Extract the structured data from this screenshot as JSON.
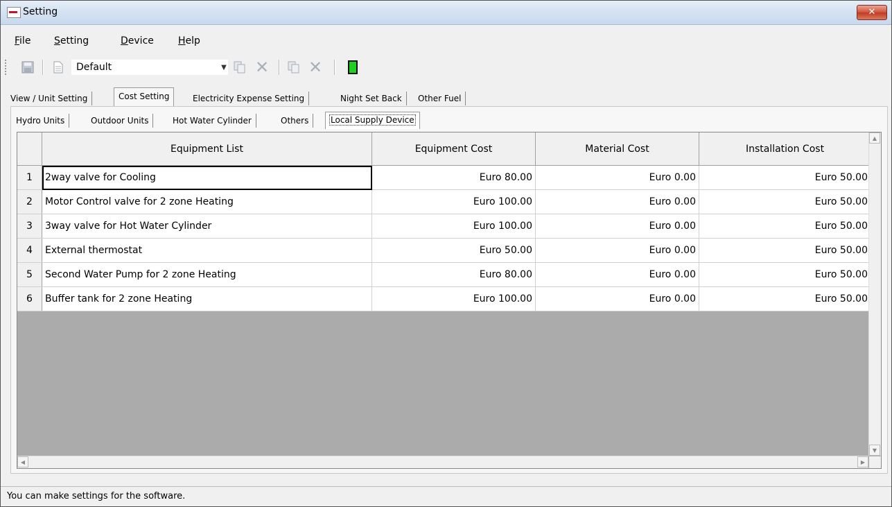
{
  "window": {
    "title": "Setting",
    "close_label": "✕"
  },
  "menu": {
    "items": [
      {
        "underline": "F",
        "rest": "ile"
      },
      {
        "underline": "S",
        "rest": "etting"
      },
      {
        "underline": "D",
        "rest": "evice"
      },
      {
        "underline": "H",
        "rest": "elp"
      }
    ]
  },
  "toolbar": {
    "profile_value": "Default"
  },
  "tabs_main": [
    "View / Unit Setting",
    "Cost Setting",
    "Electricity Expense Setting",
    "Night Set Back",
    "Other Fuel"
  ],
  "tabs_sub": [
    "Hydro Units",
    "Outdoor Units",
    "Hot Water Cylinder",
    "Others",
    "Local Supply Device"
  ],
  "table": {
    "headers": [
      "Equipment List",
      "Equipment Cost",
      "Material Cost",
      "Installation Cost"
    ],
    "rows": [
      {
        "num": "1",
        "item": "2way valve for Cooling",
        "equipment": "Euro 80.00",
        "material": "Euro 0.00",
        "installation": "Euro 50.00"
      },
      {
        "num": "2",
        "item": "Motor Control valve for 2 zone Heating",
        "equipment": "Euro 100.00",
        "material": "Euro 0.00",
        "installation": "Euro 50.00"
      },
      {
        "num": "3",
        "item": "3way valve for Hot Water Cylinder",
        "equipment": "Euro 100.00",
        "material": "Euro 0.00",
        "installation": "Euro 50.00"
      },
      {
        "num": "4",
        "item": "External thermostat",
        "equipment": "Euro 50.00",
        "material": "Euro 0.00",
        "installation": "Euro 50.00"
      },
      {
        "num": "5",
        "item": "Second Water Pump for 2 zone Heating",
        "equipment": "Euro 80.00",
        "material": "Euro 0.00",
        "installation": "Euro 50.00"
      },
      {
        "num": "6",
        "item": "Buffer tank for 2 zone Heating",
        "equipment": "Euro 100.00",
        "material": "Euro 0.00",
        "installation": "Euro 50.00"
      }
    ]
  },
  "status": {
    "text": "You can make settings for the software."
  },
  "colors": {
    "titlebar": "#d5e2f2",
    "close": "#c03b22",
    "grid_empty": "#ababab",
    "green_icon": "#1fd11f"
  }
}
